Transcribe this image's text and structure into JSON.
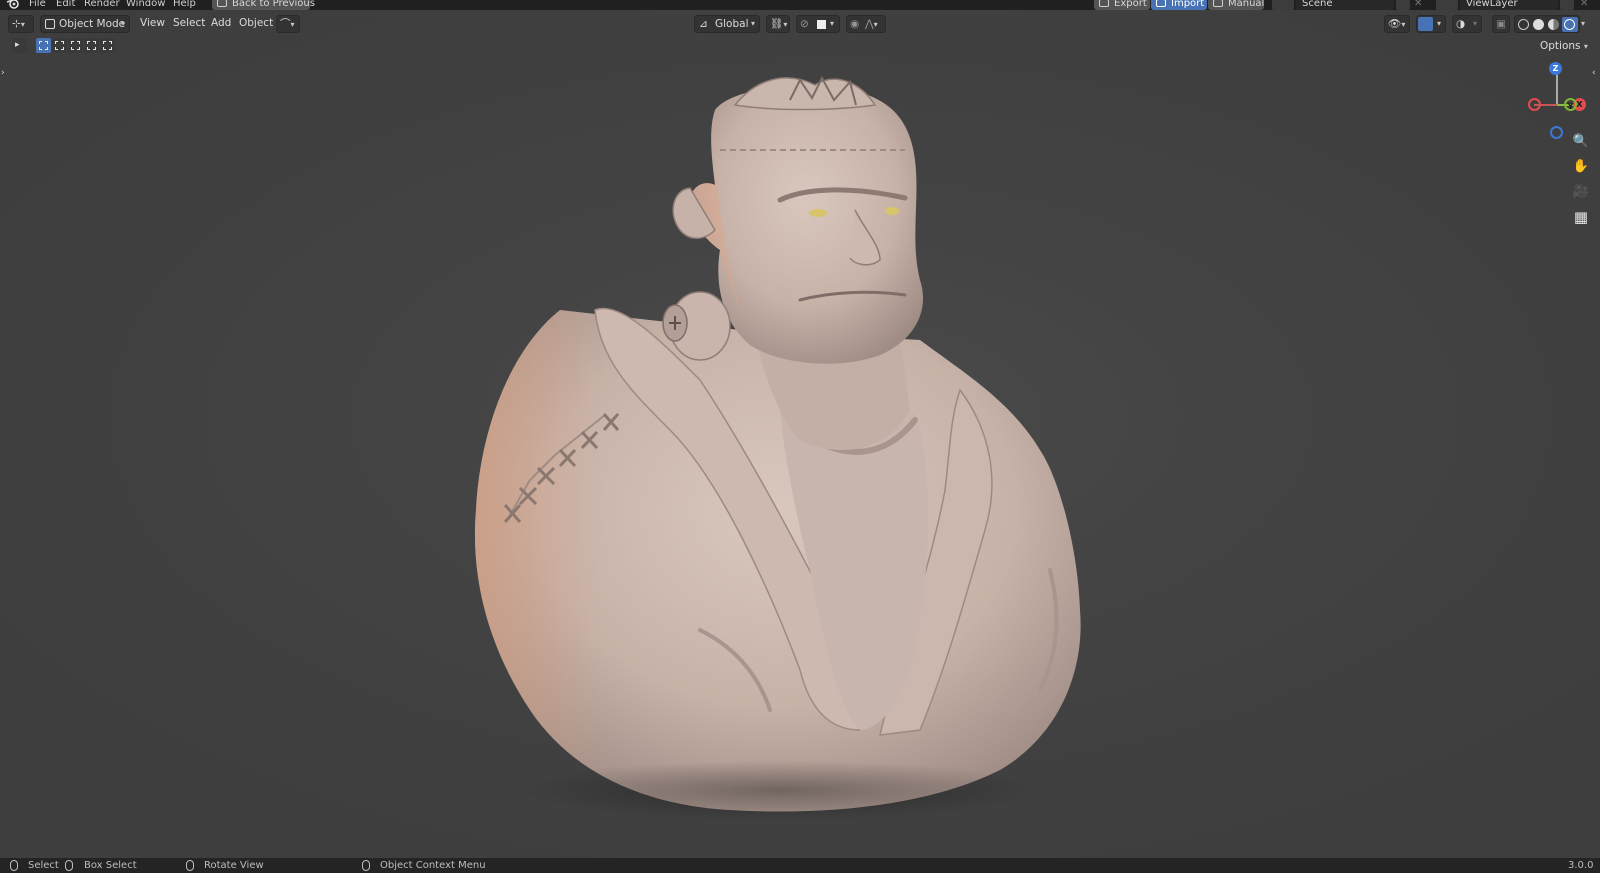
{
  "menu": {
    "items": [
      "File",
      "Edit",
      "Render",
      "Window",
      "Help"
    ],
    "back_button": "Back to Previous"
  },
  "top_right": {
    "export_label": "Export",
    "import_label": "Import",
    "manual_label": "Manual",
    "scene_name": "Scene",
    "view_layer": "ViewLayer"
  },
  "header": {
    "mode": "Object Mode",
    "menus": [
      "View",
      "Select",
      "Add",
      "Object"
    ],
    "transform_orientation": "Global",
    "options_label": "Options"
  },
  "gizmo": {
    "z": "Z",
    "x": "X",
    "y": "Y"
  },
  "statusbar": {
    "select": "Select",
    "box_select": "Box Select",
    "rotate_view": "Rotate View",
    "context_menu": "Object Context Menu",
    "version": "3.0.0"
  },
  "colors": {
    "accent": "#4772b3",
    "axis_x": "#e24c4c",
    "axis_y": "#7fb834",
    "axis_z": "#3b78d8",
    "sculpt_base": "#c9b6ad"
  },
  "icons": {
    "blender_logo": "blender-logo-icon",
    "zoom": "zoom-icon",
    "pan": "hand-icon",
    "camera": "camera-icon",
    "grid": "grid-icon"
  }
}
